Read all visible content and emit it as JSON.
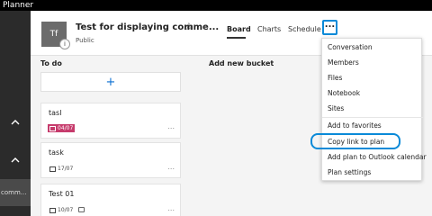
{
  "app": {
    "name": "Planner"
  },
  "sidebar": {
    "active_label": "comm..."
  },
  "header": {
    "avatar_initials": "Tf",
    "info_badge": "i",
    "title": "Test for displaying comme...",
    "subtitle": "Public",
    "tabs": [
      {
        "label": "Board",
        "active": true
      },
      {
        "label": "Charts",
        "active": false
      },
      {
        "label": "Schedule",
        "active": false
      }
    ],
    "more_label": "..."
  },
  "buckets": {
    "todo_title": "To do",
    "add_bucket_label": "Add new bucket",
    "add_task_symbol": "+"
  },
  "tasks": [
    {
      "title": "tasl",
      "due": "04/07",
      "overdue": true,
      "has_comment": false
    },
    {
      "title": "task",
      "due": "17/07",
      "overdue": false,
      "has_comment": false
    },
    {
      "title": "Test 01",
      "due": "10/07",
      "overdue": false,
      "has_comment": true
    }
  ],
  "card_more": "...",
  "menu": {
    "items": [
      "Conversation",
      "Members",
      "Files",
      "Notebook",
      "Sites",
      "Add to favorites",
      "Copy link to plan",
      "Add plan to Outlook calendar",
      "Plan settings"
    ]
  },
  "colors": {
    "accent": "#0a8ad8",
    "overdue": "#c63b6c",
    "nav": "#2b2b2b",
    "topbar": "#000000"
  }
}
